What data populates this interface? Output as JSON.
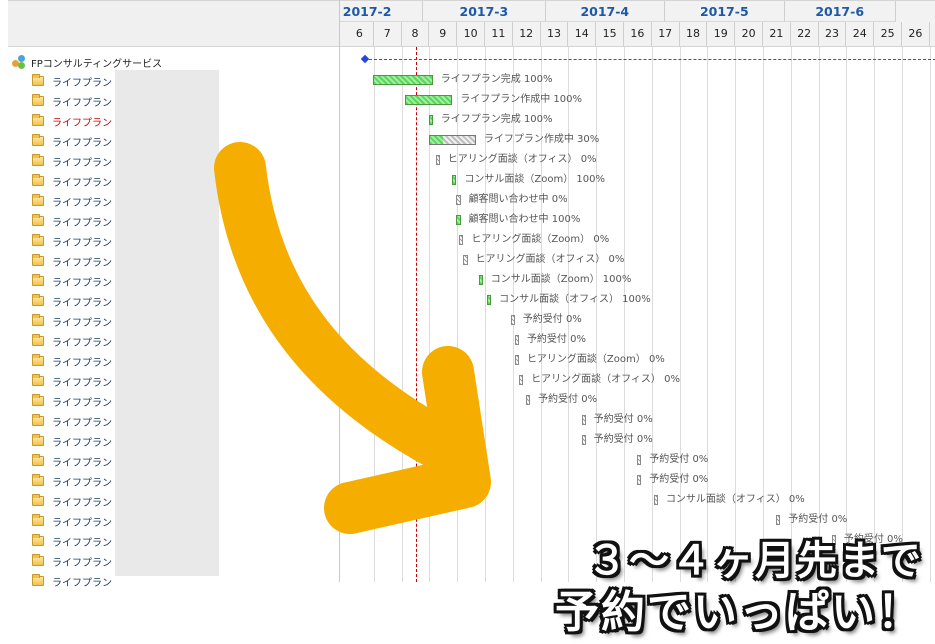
{
  "tree": {
    "root_label": "FPコンサルティングサービス",
    "rows": [
      {
        "label": "ライフプラン",
        "highlight": false
      },
      {
        "label": "ライフプラン",
        "highlight": false
      },
      {
        "label": "ライフプラン",
        "highlight": true
      },
      {
        "label": "ライフプラン",
        "highlight": false
      },
      {
        "label": "ライフプラン",
        "highlight": false
      },
      {
        "label": "ライフプラン",
        "highlight": false
      },
      {
        "label": "ライフプラン",
        "highlight": false
      },
      {
        "label": "ライフプラン",
        "highlight": false
      },
      {
        "label": "ライフプラン",
        "highlight": false
      },
      {
        "label": "ライフプラン",
        "highlight": false
      },
      {
        "label": "ライフプラン",
        "highlight": false
      },
      {
        "label": "ライフプラン",
        "highlight": false
      },
      {
        "label": "ライフプラン",
        "highlight": false
      },
      {
        "label": "ライフプラン",
        "highlight": false
      },
      {
        "label": "ライフプラン",
        "highlight": false
      },
      {
        "label": "ライフプラン",
        "highlight": false
      },
      {
        "label": "ライフプラン",
        "highlight": false
      },
      {
        "label": "ライフプラン",
        "highlight": false
      },
      {
        "label": "ライフプラン",
        "highlight": false
      },
      {
        "label": "ライフプラン",
        "highlight": false
      },
      {
        "label": "ライフプラン",
        "highlight": false
      },
      {
        "label": "ライフプラン",
        "highlight": false
      },
      {
        "label": "ライフプラン",
        "highlight": false
      },
      {
        "label": "ライフプラン",
        "highlight": false
      },
      {
        "label": "ライフプラン",
        "highlight": false
      },
      {
        "label": "ライフプラン",
        "highlight": false
      }
    ]
  },
  "timeline": {
    "months": [
      {
        "label": "2017-2"
      },
      {
        "label": "2017-3"
      },
      {
        "label": "2017-4"
      },
      {
        "label": "2017-5"
      },
      {
        "label": "2017-6"
      }
    ],
    "weeks": [
      "6",
      "7",
      "8",
      "9",
      "10",
      "11",
      "12",
      "13",
      "14",
      "15",
      "16",
      "17",
      "18",
      "19",
      "20",
      "21",
      "22",
      "23",
      "24",
      "25",
      "26"
    ],
    "today_week": 8
  },
  "tasks": [
    {
      "label": "ライフプラン完成 100%",
      "start": 6.0,
      "end": 8.15,
      "progress": 100
    },
    {
      "label": "ライフプラン作成中 100%",
      "start": 7.15,
      "end": 8.85,
      "progress": 100
    },
    {
      "label": "ライフプラン完成 100%",
      "start": 8.0,
      "end": 8.15,
      "progress": 100
    },
    {
      "label": "ライフプラン作成中 30%",
      "start": 8.0,
      "end": 9.7,
      "progress": 30
    },
    {
      "label": "ヒアリング面談（オフィス） 0%",
      "start": 8.25,
      "end": 8.4,
      "progress": 0
    },
    {
      "label": "コンサル面談（Zoom） 100%",
      "start": 8.85,
      "end": 9.0,
      "progress": 100
    },
    {
      "label": "顧客問い合わせ中 0%",
      "start": 9.0,
      "end": 9.15,
      "progress": 0
    },
    {
      "label": "顧客問い合わせ中 100%",
      "start": 9.0,
      "end": 9.15,
      "progress": 100
    },
    {
      "label": "ヒアリング面談（Zoom） 0%",
      "start": 9.1,
      "end": 9.25,
      "progress": 0
    },
    {
      "label": "ヒアリング面談（オフィス） 0%",
      "start": 9.25,
      "end": 9.4,
      "progress": 0
    },
    {
      "label": "コンサル面談（Zoom） 100%",
      "start": 9.8,
      "end": 9.95,
      "progress": 100
    },
    {
      "label": "コンサル面談（オフィス） 100%",
      "start": 10.1,
      "end": 10.25,
      "progress": 100
    },
    {
      "label": "予約受付 0%",
      "start": 10.95,
      "end": 11.1,
      "progress": 0
    },
    {
      "label": "予約受付 0%",
      "start": 11.1,
      "end": 11.25,
      "progress": 0
    },
    {
      "label": "ヒアリング面談（Zoom） 0%",
      "start": 11.1,
      "end": 11.25,
      "progress": 0
    },
    {
      "label": "ヒアリング面談（オフィス） 0%",
      "start": 11.25,
      "end": 11.4,
      "progress": 0
    },
    {
      "label": "予約受付 0%",
      "start": 11.5,
      "end": 11.65,
      "progress": 0
    },
    {
      "label": "予約受付 0%",
      "start": 13.5,
      "end": 13.65,
      "progress": 0
    },
    {
      "label": "予約受付 0%",
      "start": 13.5,
      "end": 13.65,
      "progress": 0
    },
    {
      "label": "予約受付 0%",
      "start": 15.5,
      "end": 15.65,
      "progress": 0
    },
    {
      "label": "予約受付 0%",
      "start": 15.5,
      "end": 15.65,
      "progress": 0
    },
    {
      "label": "コンサル面談（オフィス） 0%",
      "start": 16.1,
      "end": 16.25,
      "progress": 0
    },
    {
      "label": "予約受付 0%",
      "start": 20.5,
      "end": 20.65,
      "progress": 0
    },
    {
      "label": "予約受付 0%",
      "start": 22.5,
      "end": 22.65,
      "progress": 0
    }
  ],
  "milestone": {
    "week": 6.3
  },
  "overlay": {
    "line1": "３～４ヶ月先まで",
    "line2": "予約でいっぱい！",
    "arrow_color": "#f5ad00"
  }
}
